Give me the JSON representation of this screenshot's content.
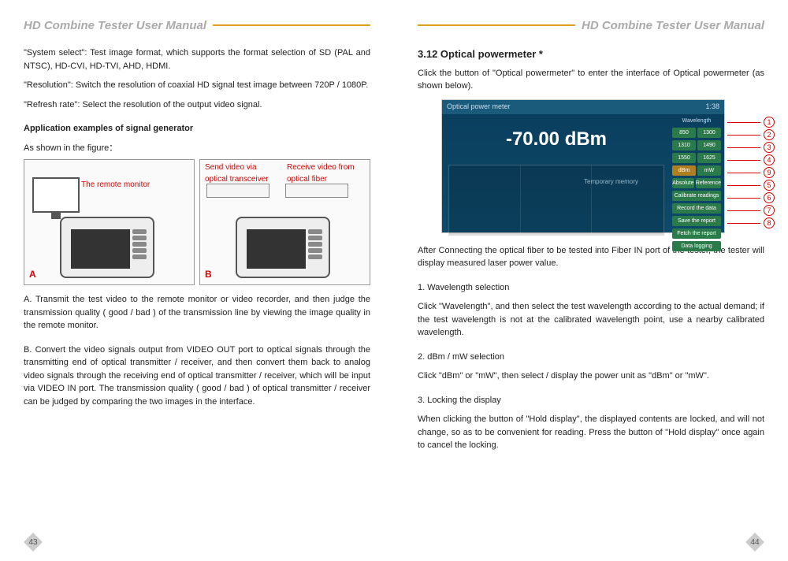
{
  "header": {
    "title": "HD Combine Tester User Manual"
  },
  "left": {
    "p1": "\"System select\": Test image format, which supports the format selection of SD (PAL and NTSC), HD-CVI, HD-TVI, AHD, HDMI.",
    "p2": "\"Resolution\": Switch the resolution of coaxial HD signal test image between 720P / 1080P.",
    "p3": "\"Refresh rate\": Select the resolution of the output video signal.",
    "app_title": "Application examples of signal generator",
    "app_intro": "As shown in the figure：",
    "diagA": {
      "label_a": "A",
      "monitor_label": "The remote monitor"
    },
    "diagB": {
      "label_b": "B",
      "send_label": "Send video via optical transceiver",
      "recv_label": "Receive video from optical fiber"
    },
    "pA": "A. Transmit the test video to the remote monitor or video recorder, and then judge the transmission quality ( good / bad ) of the transmission line by viewing the image quality in the remote monitor.",
    "pB": "B. Convert the video signals output from VIDEO OUT port to optical signals through the transmitting end of optical transmitter / receiver, and then convert them back to analog video signals through the receiving end of optical transmitter / receiver, which will be input via VIDEO IN port. The transmission quality ( good / bad ) of optical transmitter / receiver can be judged by comparing the two images in the interface.",
    "page_num": "43"
  },
  "right": {
    "section_title": "3.12 Optical powermeter *",
    "intro": "Click the button of \"Optical powermeter\" to enter the interface of Optical powermeter (as shown below).",
    "opm": {
      "title": "Optical power meter",
      "time": "1:38",
      "reading": "-70.00 dBm",
      "wavelength_label": "Wavelength",
      "temp_memory": "Temporary memory",
      "side": {
        "row1a": "850",
        "row1b": "1300",
        "row2a": "1310",
        "row2b": "1490",
        "row3a": "1550",
        "row3b": "1625",
        "row4a": "dBm",
        "row4b": "mW",
        "row5a": "Absolute",
        "row5b": "Reference",
        "btn6": "Calibrate readings",
        "btn7": "Record the data",
        "btn8": "Save the report",
        "btn9": "Fetch the report",
        "btn10": "Data logging"
      },
      "callout_order": [
        "1",
        "2",
        "3",
        "4",
        "9",
        "5",
        "6",
        "7",
        "8"
      ]
    },
    "after": "After Connecting the optical fiber to be tested into Fiber IN port of the tester, the tester will display measured laser power value.",
    "s1_title": "1. Wavelength selection",
    "s1_body": "Click \"Wavelength\", and then select the test wavelength according to the actual demand; if the test wavelength is not at the calibrated wavelength point, use a nearby calibrated wavelength.",
    "s2_title": "2. dBm / mW selection",
    "s2_body": "Click \"dBm\" or \"mW\", then select / display the power unit as \"dBm\" or \"mW\".",
    "s3_title": "3. Locking the display",
    "s3_body": "When clicking the button of \"Hold display\", the displayed contents are locked, and will not change, so as to be convenient for reading. Press the button of \"Hold display\" once again to cancel the locking.",
    "page_num": "44"
  }
}
